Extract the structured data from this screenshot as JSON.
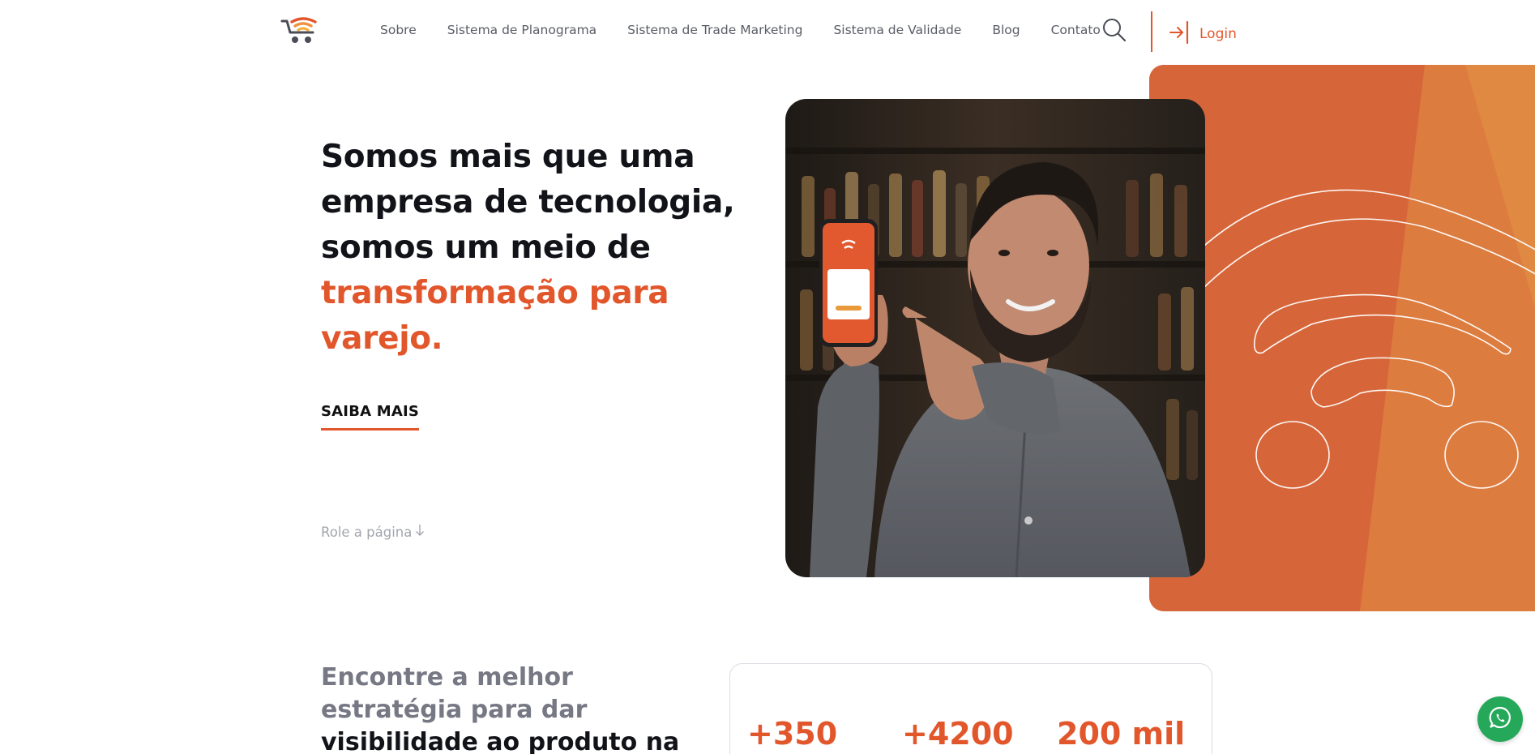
{
  "header": {
    "nav": [
      "Sobre",
      "Sistema de Planograma",
      "Sistema de Trade Marketing",
      "Sistema de Validade",
      "Blog",
      "Contato"
    ],
    "login_label": "Login",
    "logo_icon": "cart-wifi-logo-icon",
    "search_icon": "search-icon",
    "login_icon": "login-arrow-icon"
  },
  "hero": {
    "title_line1": "Somos mais que uma",
    "title_line2": "empresa de tecnologia,",
    "title_line3": "somos um meio de",
    "title_accent_line1": "transformação para",
    "title_accent_line2": "varejo.",
    "cta_label": "SAIBA MAIS",
    "scroll_label": "Role a página",
    "scroll_icon": "arrow-down-icon"
  },
  "section": {
    "strategy_muted": "Encontre a melhor estratégia para dar",
    "strategy_dark": "visibilidade ao produto na gôndola",
    "stats": [
      "+350",
      "+4200",
      "200 mil"
    ]
  },
  "colors": {
    "accent": "#e2562c",
    "panel_orange": "#d96a3a",
    "whatsapp_green": "#25a85a",
    "nav_text": "#5a5d66"
  },
  "whatsapp_icon": "whatsapp-icon"
}
